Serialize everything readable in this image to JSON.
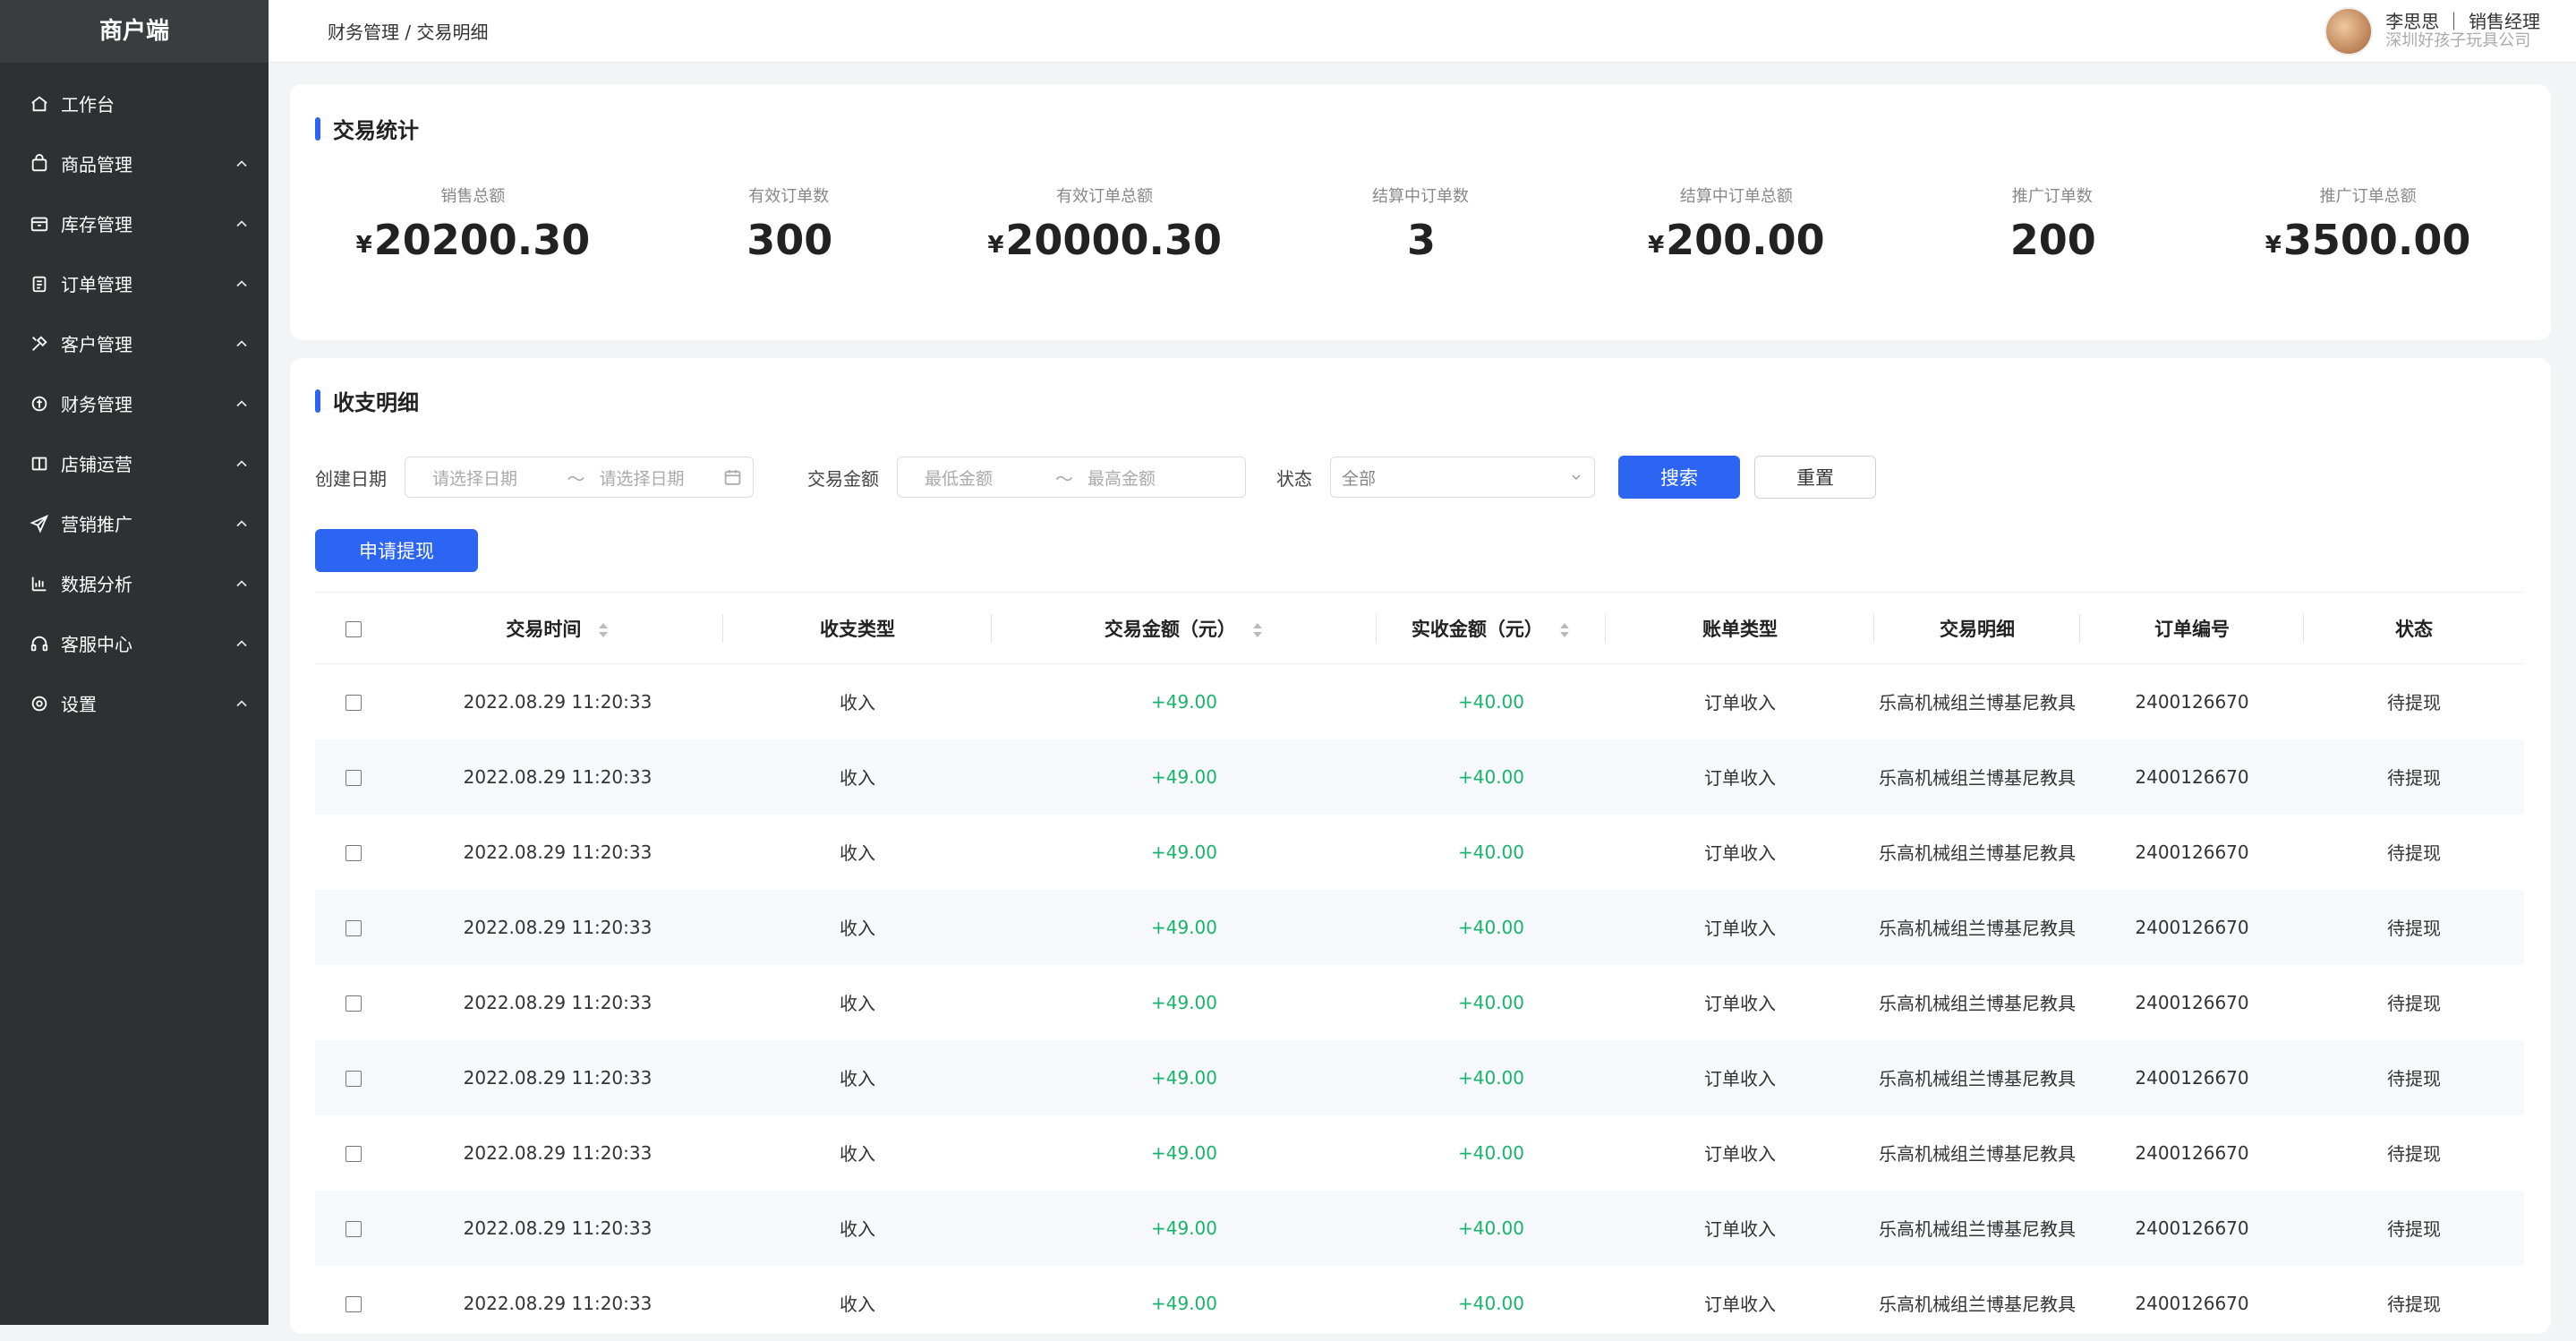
{
  "sidebar": {
    "brand": "商户端",
    "items": [
      {
        "label": "工作台",
        "icon": "home-icon",
        "has_chevron": false
      },
      {
        "label": "商品管理",
        "icon": "bag-icon",
        "has_chevron": true
      },
      {
        "label": "库存管理",
        "icon": "box-icon",
        "has_chevron": true
      },
      {
        "label": "订单管理",
        "icon": "clipboard-icon",
        "has_chevron": true
      },
      {
        "label": "客户管理",
        "icon": "tools-icon",
        "has_chevron": true
      },
      {
        "label": "财务管理",
        "icon": "finance-icon",
        "has_chevron": true
      },
      {
        "label": "店铺运营",
        "icon": "book-icon",
        "has_chevron": true
      },
      {
        "label": "营销推广",
        "icon": "send-icon",
        "has_chevron": true
      },
      {
        "label": "数据分析",
        "icon": "chart-icon",
        "has_chevron": true
      },
      {
        "label": "客服中心",
        "icon": "headset-icon",
        "has_chevron": true
      },
      {
        "label": "设置",
        "icon": "settings-icon",
        "has_chevron": true
      }
    ]
  },
  "header": {
    "breadcrumb": "财务管理 / 交易明细",
    "user_line1": "李思思 ｜ 销售经理",
    "user_line2": "深圳好孩子玩具公司"
  },
  "stats": {
    "title": "交易统计",
    "items": [
      {
        "label": "销售总额",
        "currency": "¥",
        "value": "20200.30"
      },
      {
        "label": "有效订单数",
        "currency": "",
        "value": "300"
      },
      {
        "label": "有效订单总额",
        "currency": "¥",
        "value": "20000.30"
      },
      {
        "label": "结算中订单数",
        "currency": "",
        "value": "3"
      },
      {
        "label": "结算中订单总额",
        "currency": "¥",
        "value": "200.00"
      },
      {
        "label": "推广订单数",
        "currency": "",
        "value": "200"
      },
      {
        "label": "推广订单总额",
        "currency": "¥",
        "value": "3500.00"
      }
    ]
  },
  "details": {
    "title": "收支明细",
    "filters": {
      "date_label": "创建日期",
      "date_start_ph": "请选择日期",
      "tilde": "～",
      "date_end_ph": "请选择日期",
      "amount_label": "交易金额",
      "amount_min_ph": "最低金额",
      "amount_max_ph": "最高金额",
      "status_label": "状态",
      "status_value": "全部",
      "search": "搜索",
      "reset": "重置"
    },
    "apply_btn": "申请提现",
    "columns": [
      "交易时间",
      "收支类型",
      "交易金额（元）",
      "实收金额（元）",
      "账单类型",
      "交易明细",
      "订单编号",
      "状态"
    ],
    "rows": [
      [
        "2022.08.29 11:20:33",
        "收入",
        "+49.00",
        "+40.00",
        "订单收入",
        "乐高机械组兰博基尼教具",
        "2400126670",
        "待提现"
      ],
      [
        "2022.08.29 11:20:33",
        "收入",
        "+49.00",
        "+40.00",
        "订单收入",
        "乐高机械组兰博基尼教具",
        "2400126670",
        "待提现"
      ],
      [
        "2022.08.29 11:20:33",
        "收入",
        "+49.00",
        "+40.00",
        "订单收入",
        "乐高机械组兰博基尼教具",
        "2400126670",
        "待提现"
      ],
      [
        "2022.08.29 11:20:33",
        "收入",
        "+49.00",
        "+40.00",
        "订单收入",
        "乐高机械组兰博基尼教具",
        "2400126670",
        "待提现"
      ],
      [
        "2022.08.29 11:20:33",
        "收入",
        "+49.00",
        "+40.00",
        "订单收入",
        "乐高机械组兰博基尼教具",
        "2400126670",
        "待提现"
      ],
      [
        "2022.08.29 11:20:33",
        "收入",
        "+49.00",
        "+40.00",
        "订单收入",
        "乐高机械组兰博基尼教具",
        "2400126670",
        "待提现"
      ],
      [
        "2022.08.29 11:20:33",
        "收入",
        "+49.00",
        "+40.00",
        "订单收入",
        "乐高机械组兰博基尼教具",
        "2400126670",
        "待提现"
      ],
      [
        "2022.08.29 11:20:33",
        "收入",
        "+49.00",
        "+40.00",
        "订单收入",
        "乐高机械组兰博基尼教具",
        "2400126670",
        "待提现"
      ],
      [
        "2022.08.29 11:20:33",
        "收入",
        "+49.00",
        "+40.00",
        "订单收入",
        "乐高机械组兰博基尼教具",
        "2400126670",
        "待提现"
      ]
    ]
  },
  "colors": {
    "sidebar_bg": "#2f3033",
    "primary": "#2c65f2",
    "positive": "#18b46d",
    "stripe": "#f7f8fb"
  }
}
